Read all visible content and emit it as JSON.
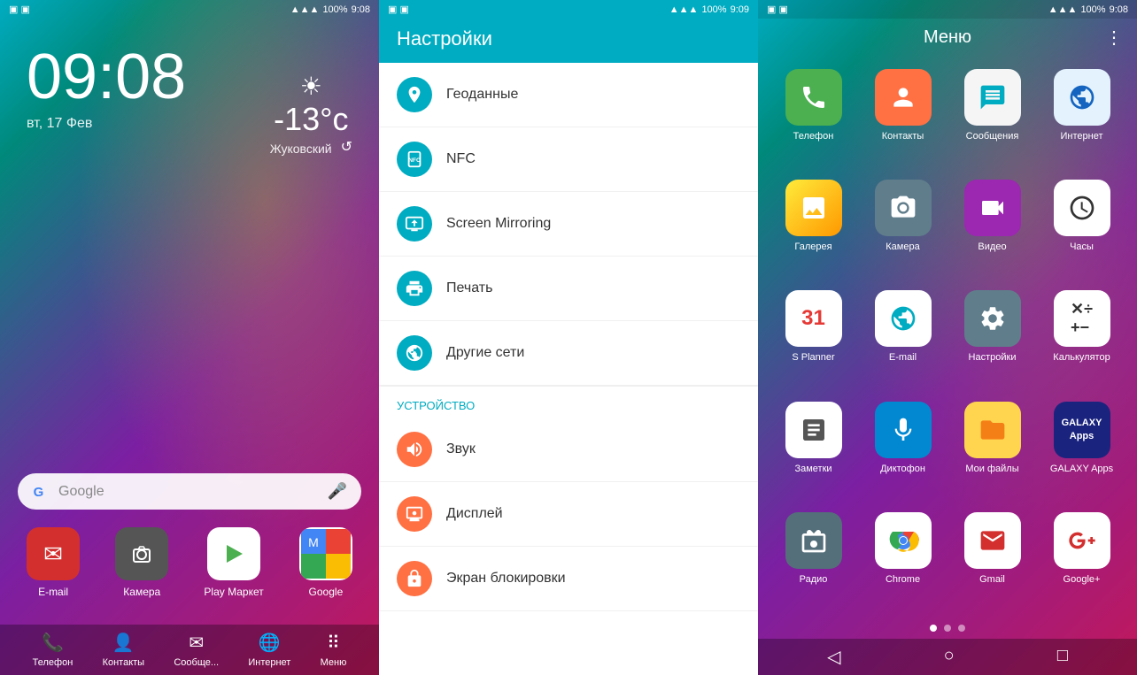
{
  "lock_screen": {
    "status_bar": {
      "left_icons": "▣ ▣",
      "signal": "▲▲▲",
      "battery": "100%",
      "time": "9:08"
    },
    "time": "09:08",
    "date": "вт, 17 Фев",
    "weather": {
      "temp": "-13°с",
      "city": "Жуковский"
    },
    "search_placeholder": "Google",
    "apps": [
      {
        "label": "E-mail",
        "icon": "✉",
        "type": "email"
      },
      {
        "label": "Камера",
        "icon": "📷",
        "type": "camera"
      },
      {
        "label": "Play\nМаркет",
        "icon": "▶",
        "type": "playstore"
      },
      {
        "label": "Google",
        "icon": "G",
        "type": "google-maps"
      }
    ],
    "bottom_nav": [
      {
        "label": "Телефон",
        "icon": "📞"
      },
      {
        "label": "Контакты",
        "icon": "👤"
      },
      {
        "label": "Сообще...",
        "icon": "✉"
      },
      {
        "label": "Интернет",
        "icon": "🌐"
      },
      {
        "label": "Меню",
        "icon": "⠿"
      }
    ]
  },
  "settings": {
    "title": "Настройки",
    "status_bar_time": "9:09",
    "items": [
      {
        "label": "Геоданные",
        "icon": "📍",
        "color": "blue"
      },
      {
        "label": "NFC",
        "icon": "📲",
        "color": "blue"
      },
      {
        "label": "Screen Mirroring",
        "icon": "📺",
        "color": "blue"
      },
      {
        "label": "Печать",
        "icon": "🖨",
        "color": "blue"
      },
      {
        "label": "Другие сети",
        "icon": "📡",
        "color": "blue"
      }
    ],
    "section_device": "УСТРОЙСТВО",
    "device_items": [
      {
        "label": "Звук",
        "icon": "🔊",
        "color": "orange"
      },
      {
        "label": "Дисплей",
        "icon": "📱",
        "color": "orange"
      },
      {
        "label": "Экран блокировки",
        "icon": "🔒",
        "color": "orange"
      }
    ]
  },
  "app_drawer": {
    "title": "Меню",
    "status_bar_time": "9:08",
    "apps": [
      {
        "label": "Телефон",
        "type": "phone"
      },
      {
        "label": "Контакты",
        "type": "contacts"
      },
      {
        "label": "Сообщения",
        "type": "messages"
      },
      {
        "label": "Интернет",
        "type": "internet"
      },
      {
        "label": "Галерея",
        "type": "gallery"
      },
      {
        "label": "Камера",
        "type": "camera2"
      },
      {
        "label": "Видео",
        "type": "video"
      },
      {
        "label": "Часы",
        "type": "clock"
      },
      {
        "label": "S Planner",
        "type": "calendar"
      },
      {
        "label": "E-mail",
        "type": "emailapp"
      },
      {
        "label": "Настройки",
        "type": "settingsapp"
      },
      {
        "label": "Калькулято р",
        "type": "calc"
      },
      {
        "label": "Заметки",
        "type": "notes"
      },
      {
        "label": "Диктофон",
        "type": "recorder"
      },
      {
        "label": "Мои файлы",
        "type": "files"
      },
      {
        "label": "GALAXY Apps",
        "type": "galaxy"
      },
      {
        "label": "Радио",
        "type": "radio"
      },
      {
        "label": "Chrome",
        "type": "chrome"
      },
      {
        "label": "Gmail",
        "type": "gmail"
      },
      {
        "label": "Google+",
        "type": "googleplus"
      }
    ],
    "page_dots": [
      {
        "active": true
      },
      {
        "active": false
      },
      {
        "active": false
      }
    ]
  }
}
